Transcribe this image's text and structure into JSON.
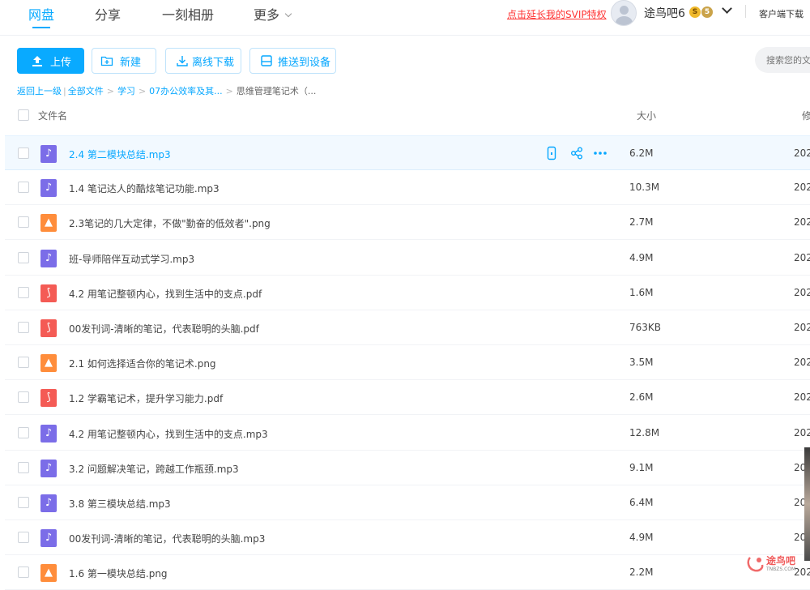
{
  "nav": {
    "tabs": [
      {
        "label": "网盘",
        "active": true
      },
      {
        "label": "分享",
        "active": false
      },
      {
        "label": "一刻相册",
        "active": false
      },
      {
        "label": "更多",
        "active": false
      }
    ],
    "promo_link": "点击延长我的SVIP特权",
    "username": "途鸟吧6",
    "badges": [
      "S",
      "5"
    ],
    "client_download": "客户端下载"
  },
  "toolbar": {
    "upload_label": "上传",
    "new_label": "新建",
    "offline_label": "离线下载",
    "push_label": "推送到设备",
    "search_placeholder": "搜索您的文件"
  },
  "breadcrumb": {
    "back": "返回上一级",
    "items": [
      "全部文件",
      "学习",
      "07办公效率及其...",
      "思维管理笔记术（..."
    ]
  },
  "table": {
    "headers": {
      "name": "文件名",
      "size": "大小",
      "modified": "修"
    },
    "rows": [
      {
        "type": "mp3",
        "name": "2.4 第二模块总结.mp3",
        "size": "6.2M",
        "date": "202"
      },
      {
        "type": "mp3",
        "name": "1.4 笔记达人的酷炫笔记功能.mp3",
        "size": "10.3M",
        "date": "202"
      },
      {
        "type": "png",
        "name": "2.3笔记的几大定律，不做\"勤奋的低效者\".png",
        "size": "2.7M",
        "date": "202"
      },
      {
        "type": "mp3",
        "name": "班-导师陪伴互动式学习.mp3",
        "size": "4.9M",
        "date": "202"
      },
      {
        "type": "pdf",
        "name": "4.2 用笔记整顿内心，找到生活中的支点.pdf",
        "size": "1.6M",
        "date": "202"
      },
      {
        "type": "pdf",
        "name": "00发刊词-清晰的笔记，代表聪明的头脑.pdf",
        "size": "763KB",
        "date": "202"
      },
      {
        "type": "png",
        "name": "2.1 如何选择适合你的笔记术.png",
        "size": "3.5M",
        "date": "202"
      },
      {
        "type": "pdf",
        "name": "1.2 学霸笔记术，提升学习能力.pdf",
        "size": "2.6M",
        "date": "202"
      },
      {
        "type": "mp3",
        "name": "4.2 用笔记整顿内心，找到生活中的支点.mp3",
        "size": "12.8M",
        "date": "202"
      },
      {
        "type": "mp3",
        "name": "3.2 问题解决笔记，跨越工作瓶颈.mp3",
        "size": "9.1M",
        "date": "202"
      },
      {
        "type": "mp3",
        "name": "3.8 第三模块总结.mp3",
        "size": "6.4M",
        "date": "202"
      },
      {
        "type": "mp3",
        "name": "00发刊词-清晰的笔记，代表聪明的头脑.mp3",
        "size": "4.9M",
        "date": "202"
      },
      {
        "type": "png",
        "name": "1.6 第一模块总结.png",
        "size": "2.2M",
        "date": "202"
      }
    ],
    "hover_actions": [
      "phone-icon",
      "share-icon",
      "more-icon"
    ]
  },
  "watermark": {
    "text": "途鸟吧",
    "sub": "TNBZS.COM"
  },
  "colors": {
    "accent": "#09aaff",
    "promo": "#ff3333",
    "mp3": "#7b6de8",
    "png": "#ff8d3b",
    "pdf": "#f45b55",
    "hover_row": "#f2f9ff"
  }
}
